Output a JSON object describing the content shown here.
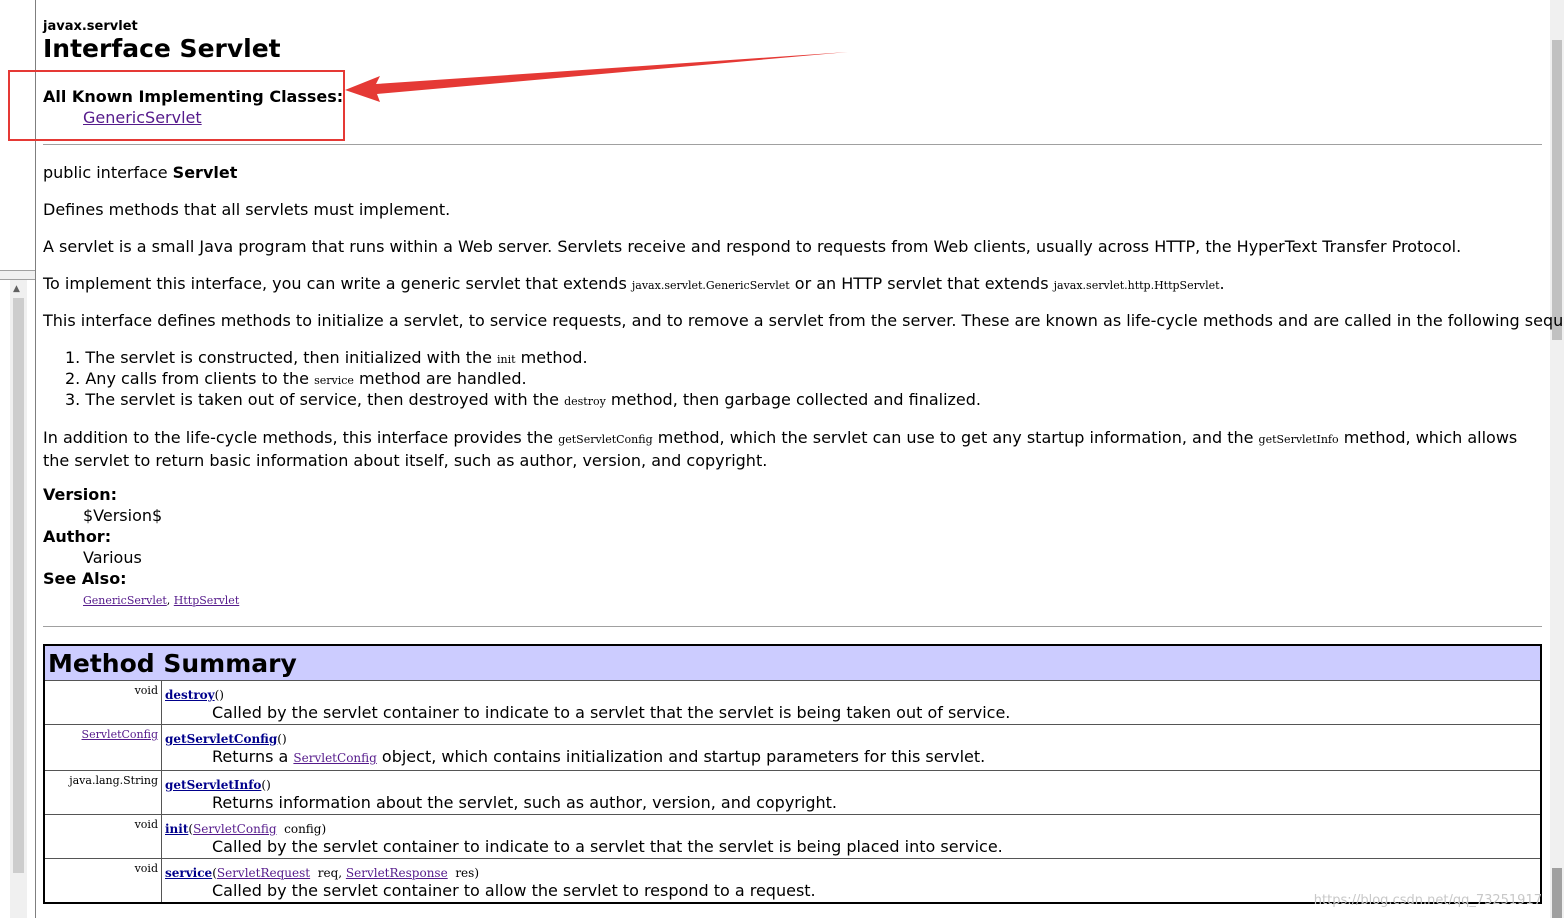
{
  "package": "javax.servlet",
  "title": "Interface Servlet",
  "implementing": {
    "label": "All Known Implementing Classes:",
    "link": "GenericServlet"
  },
  "declaration": {
    "prefix": "public interface ",
    "name": "Servlet"
  },
  "paragraphs": {
    "p1": "Defines methods that all servlets must implement.",
    "p2": "A servlet is a small Java program that runs within a Web server. Servlets receive and respond to requests from Web clients, usually across HTTP, the HyperText Transfer Protocol.",
    "p3a": "To implement this interface, you can write a generic servlet that extends ",
    "p3code1": "javax.servlet.GenericServlet",
    "p3b": " or an HTTP servlet that extends ",
    "p3code2": "javax.servlet.http.HttpServlet",
    "p3c": ".",
    "p4": "This interface defines methods to initialize a servlet, to service requests, and to remove a servlet from the server. These are known as life-cycle methods and are called in the following sequence:",
    "p5a": "In addition to the life-cycle methods, this interface provides the ",
    "p5code1": "getServletConfig",
    "p5b": " method, which the servlet can use to get any startup information, and the ",
    "p5code2": "getServletInfo",
    "p5c": " method, which allows the servlet to return basic information about itself, such as author, version, and copyright."
  },
  "list": [
    {
      "num": "1.",
      "a": "The servlet is constructed, then initialized with the ",
      "code": "init",
      "b": " method."
    },
    {
      "num": "2.",
      "a": "Any calls from clients to the ",
      "code": "service",
      "b": " method are handled."
    },
    {
      "num": "3.",
      "a": "The servlet is taken out of service, then destroyed with the ",
      "code": "destroy",
      "b": " method, then garbage collected and finalized."
    }
  ],
  "tags": {
    "version_label": "Version:",
    "version_value": "$Version$",
    "author_label": "Author:",
    "author_value": "Various",
    "see_label": "See Also:",
    "see1": "GenericServlet",
    "sep": ", ",
    "see2": "HttpServlet"
  },
  "summary": {
    "heading": "Method Summary",
    "rows": [
      {
        "type": "void",
        "name": "destroy",
        "params": "()",
        "desc": "Called by the servlet container to indicate to a servlet that the servlet is being taken out of service."
      },
      {
        "type": "ServletConfig",
        "name": "getServletConfig",
        "params": "()",
        "desc_a": "Returns a ",
        "desc_code": "ServletConfig",
        "desc_b": " object, which contains initialization and startup parameters for this servlet."
      },
      {
        "type": "java.lang.String",
        "name": "getServletInfo",
        "params": "()",
        "desc": "Returns information about the servlet, such as author, version, and copyright."
      },
      {
        "type": "void",
        "name": "init",
        "p_open": "(",
        "p_type": "ServletConfig",
        "p_rest": "  config)",
        "desc": "Called by the servlet container to indicate to a servlet that the servlet is being placed into service."
      },
      {
        "type": "void",
        "name": "service",
        "p_open": "(",
        "p_type": "ServletRequest",
        "p_mid": "  req, ",
        "p_type2": "ServletResponse",
        "p_rest": "  res)",
        "desc": "Called by the servlet container to allow the servlet to respond to a request."
      }
    ]
  },
  "watermark": "https://blog.csdn.net/qq_73251917",
  "colors": {
    "annotation": "#e53935",
    "table_header": "#ccccff",
    "link": "#551a8b"
  }
}
